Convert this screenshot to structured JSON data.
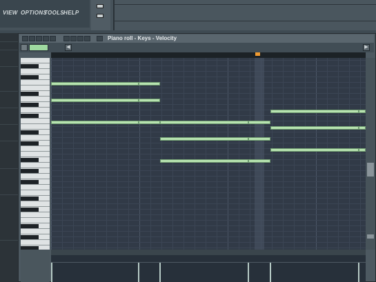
{
  "menu": {
    "items": [
      "VIEW",
      "OPTIONS",
      "TOOLS",
      "HELP"
    ]
  },
  "piano_roll": {
    "title": "Piano roll - Keys - Velocity",
    "scroll_left_glyph": "◀",
    "scroll_right_glyph": "▶"
  },
  "colors": {
    "note_fill": "#b7e3b0",
    "grid_bg": "#313a47",
    "marker": "#f09a30"
  },
  "icons": [
    "pointer-icon",
    "pencil-icon",
    "brush-icon",
    "delete-icon",
    "mute-icon",
    "slice-icon",
    "select-icon",
    "zoom-icon",
    "playback-icon",
    "snap-icon",
    "magnet-icon"
  ]
}
